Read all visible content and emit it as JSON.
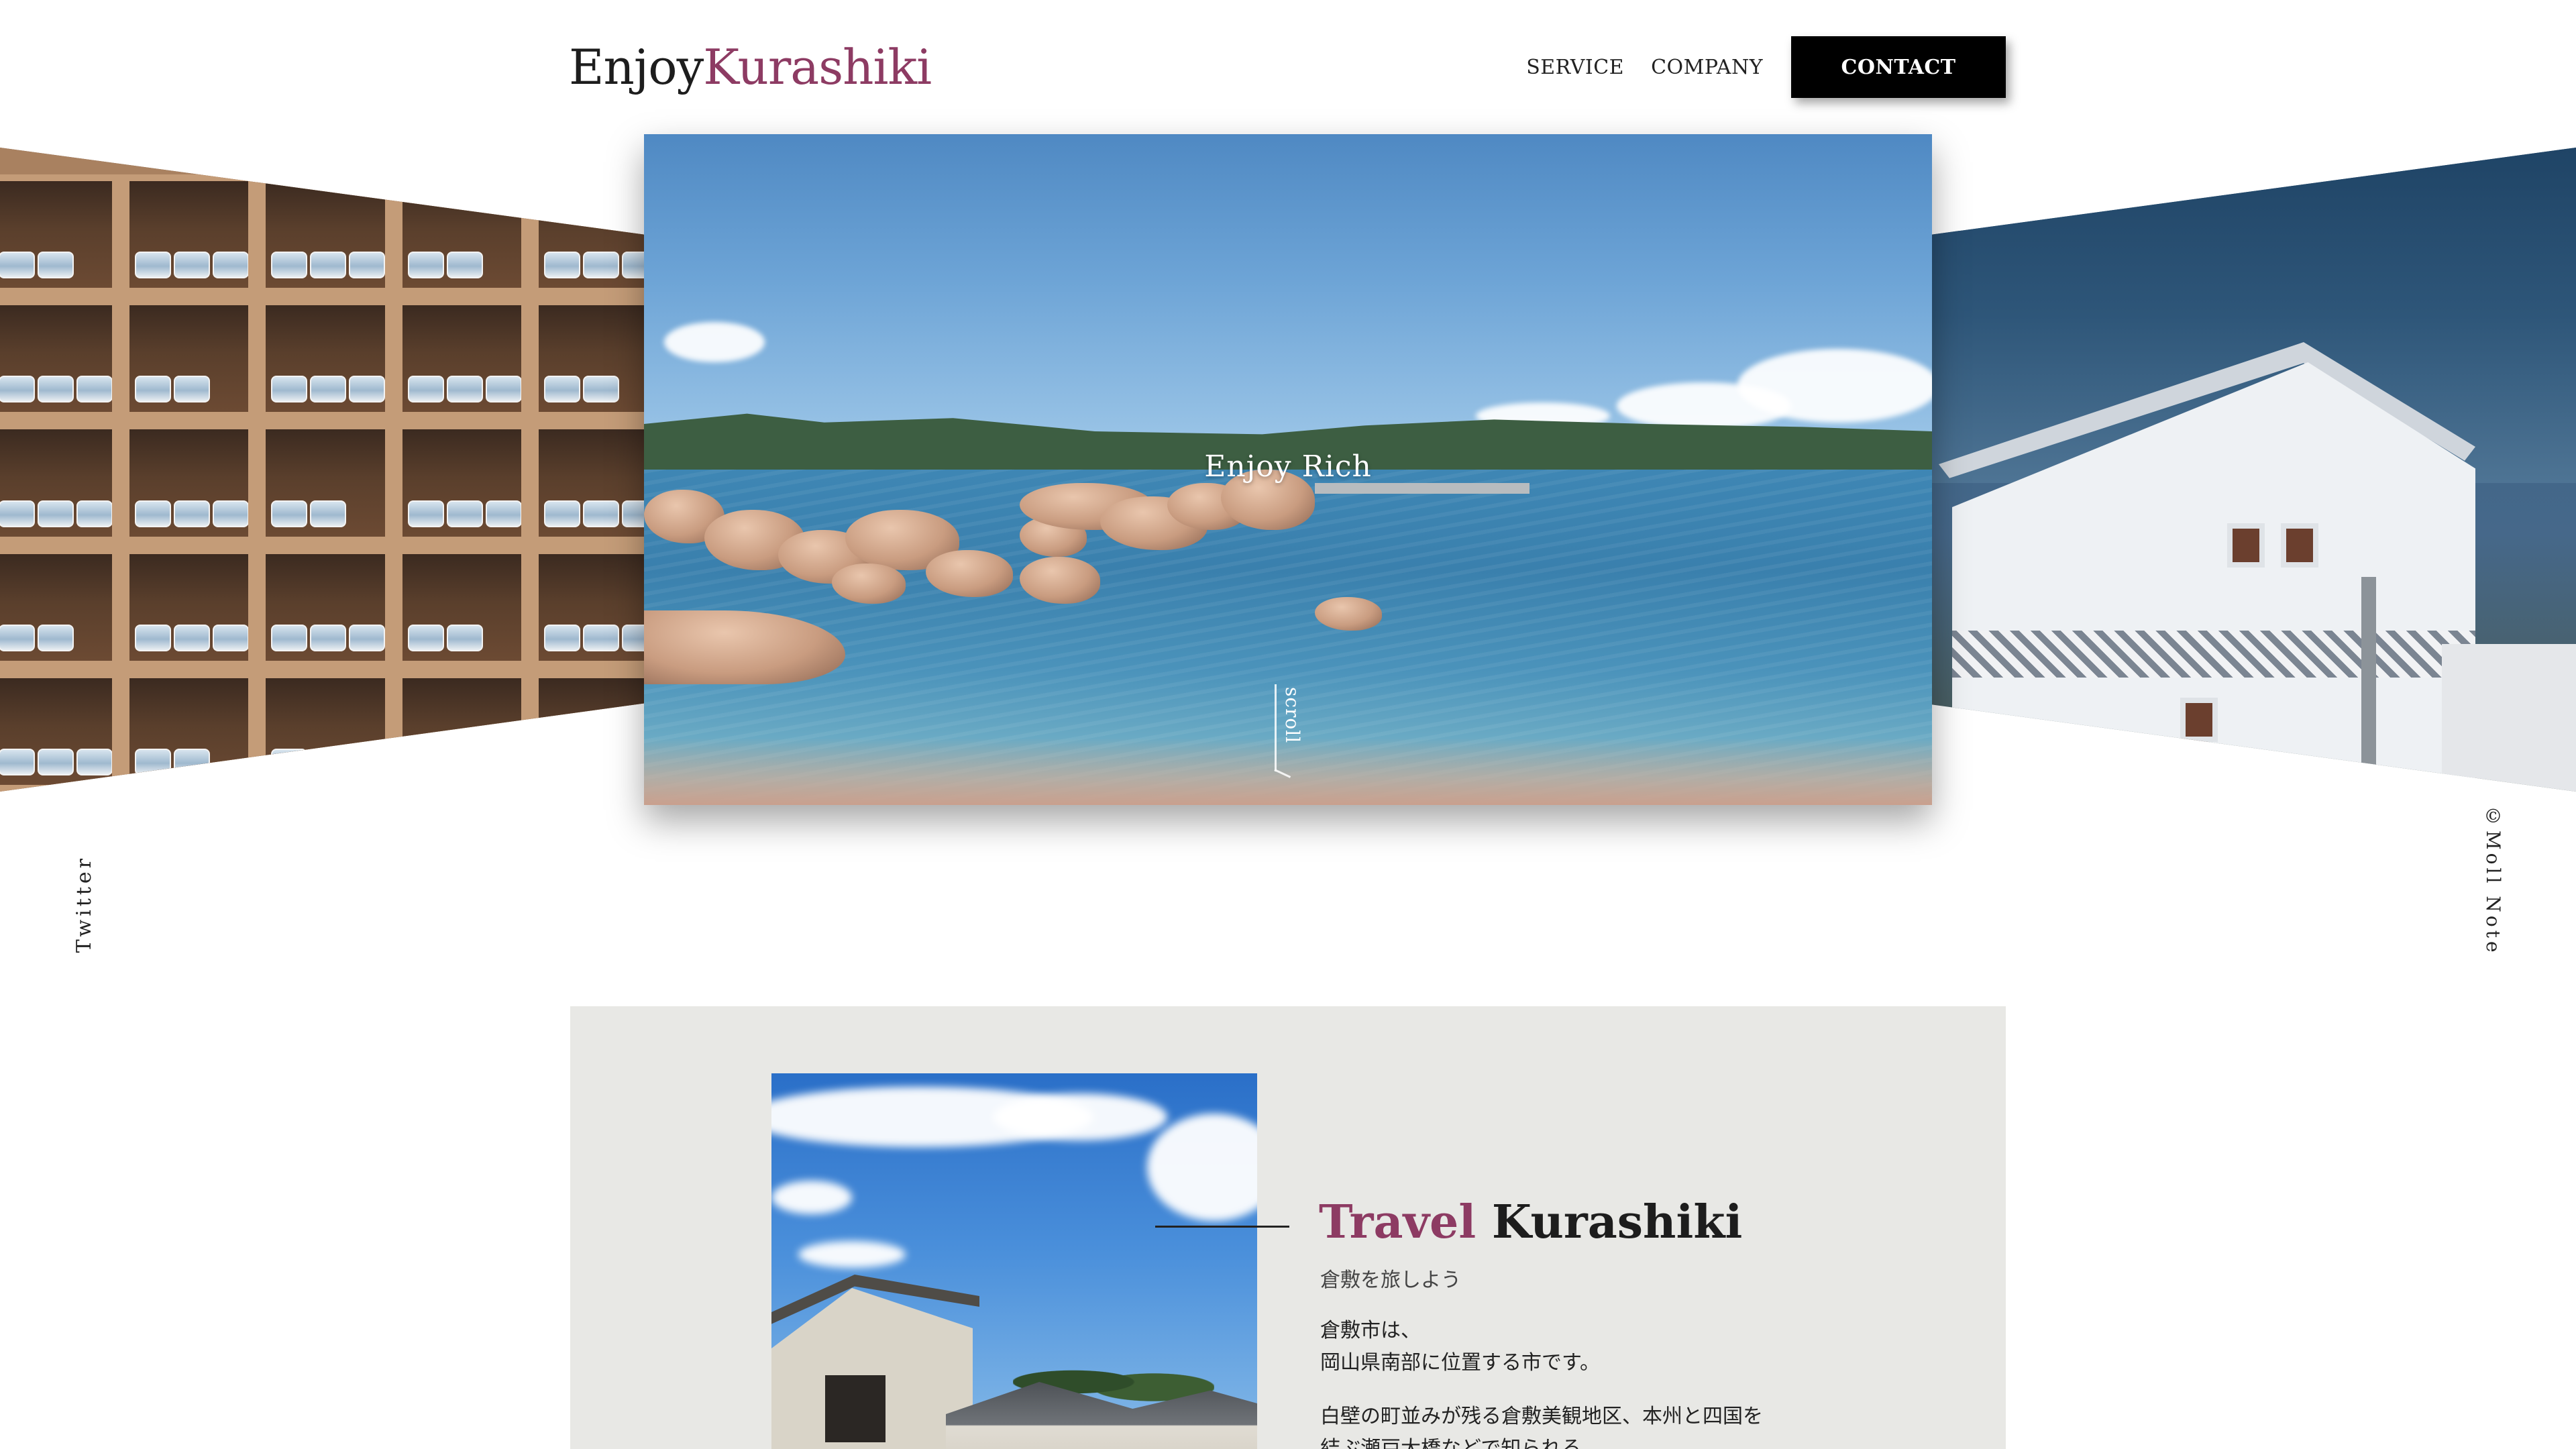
{
  "header": {
    "logo_part1": "Enjoy",
    "logo_part2": "Kurashiki",
    "nav": [
      {
        "label": "SERVICE"
      },
      {
        "label": "COMPANY"
      }
    ],
    "contact_label": "CONTACT"
  },
  "hero": {
    "title": "Enjoy Rich",
    "scroll_label": "scroll"
  },
  "side_links": {
    "twitter": "Twitter",
    "copyright": "©Moll Note"
  },
  "travel": {
    "title_accent": "Travel",
    "title_rest": "Kurashiki",
    "subtitle": "倉敷を旅しよう",
    "paragraph1_line1": "倉敷市は、",
    "paragraph1_line2": "岡山県南部に位置する市です。",
    "paragraph2_line1": "白壁の町並みが残る倉敷美観地区、本州と四国を",
    "paragraph2_line2": "結ぶ瀬戸大橋などで知られる。"
  },
  "colors": {
    "accent": "#8d3b63",
    "contact_bg": "#000000",
    "section_bg": "#e8e8e5"
  }
}
